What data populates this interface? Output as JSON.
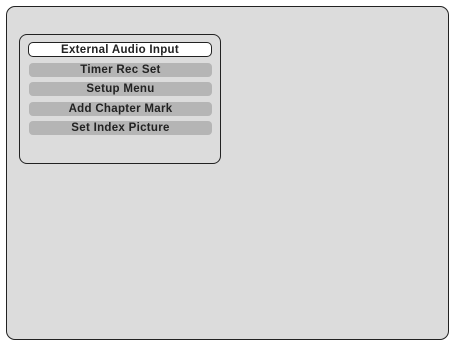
{
  "menu": {
    "items": [
      {
        "label": "External Audio Input",
        "selected": true
      },
      {
        "label": "Timer Rec Set",
        "selected": false
      },
      {
        "label": "Setup Menu",
        "selected": false
      },
      {
        "label": "Add Chapter Mark",
        "selected": false
      },
      {
        "label": "Set Index Picture",
        "selected": false
      }
    ]
  },
  "colors": {
    "screen_background": "#dcdcdc",
    "item_background": "#b5b5b5",
    "selected_background": "#ffffff",
    "border": "#222222"
  }
}
